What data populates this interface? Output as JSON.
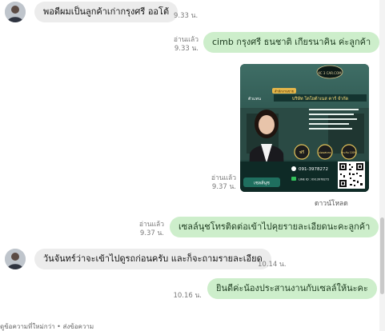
{
  "messages": [
    {
      "direction": "in",
      "text": "พอดีผมเป็นลูกค้าเก่ากรุงศรี ออโต้",
      "time": "9.33 น."
    },
    {
      "direction": "out",
      "text": "cimb กรุงศรี ธนชาติ เกียรนาคิน  ค่ะลูกค้า",
      "read": "อ่านแล้ว",
      "time": "9.33 น."
    },
    {
      "direction": "out",
      "type": "image",
      "read": "อ่านแล้ว",
      "time": "9.37 น.",
      "download": "ดาวน์โหลด"
    },
    {
      "direction": "out",
      "text": "เซลล์นุชโทรติดต่อเข้าไปคุยรายละเอียดนะคะลูกค้า",
      "read": "อ่านแล้ว",
      "time": "9.37 น."
    },
    {
      "direction": "in",
      "text": "วันจันทร์ว่าจะเข้าไปดูรถก่อนครับ และก็จะถามรายละเอียด",
      "time": "10.14 น."
    },
    {
      "direction": "out",
      "text": "ยินดีค่ะน้องประสานงานกับเซลล์ให้นะคะ",
      "time": "10.16 น."
    }
  ],
  "image_card": {
    "logo_text": "KC 3 CAR.COM",
    "headline": "บริษัท โตโยต้าเนส คาร์ จำกัด",
    "phone": "091-3978272",
    "name_tag": "เซลล์นุช",
    "line_id": "LINE ID : 0913978272",
    "badge_1": "ฟรี",
    "badge_2": "ผ่อนสบาย",
    "badge_3": "ประกัน 100%",
    "side_label": "ตัวแทน",
    "ribbon": "สำนักงานขาย"
  },
  "composer_hint": "ดูข้อความที่ใหม่กว่า • ส่งข้อความ"
}
